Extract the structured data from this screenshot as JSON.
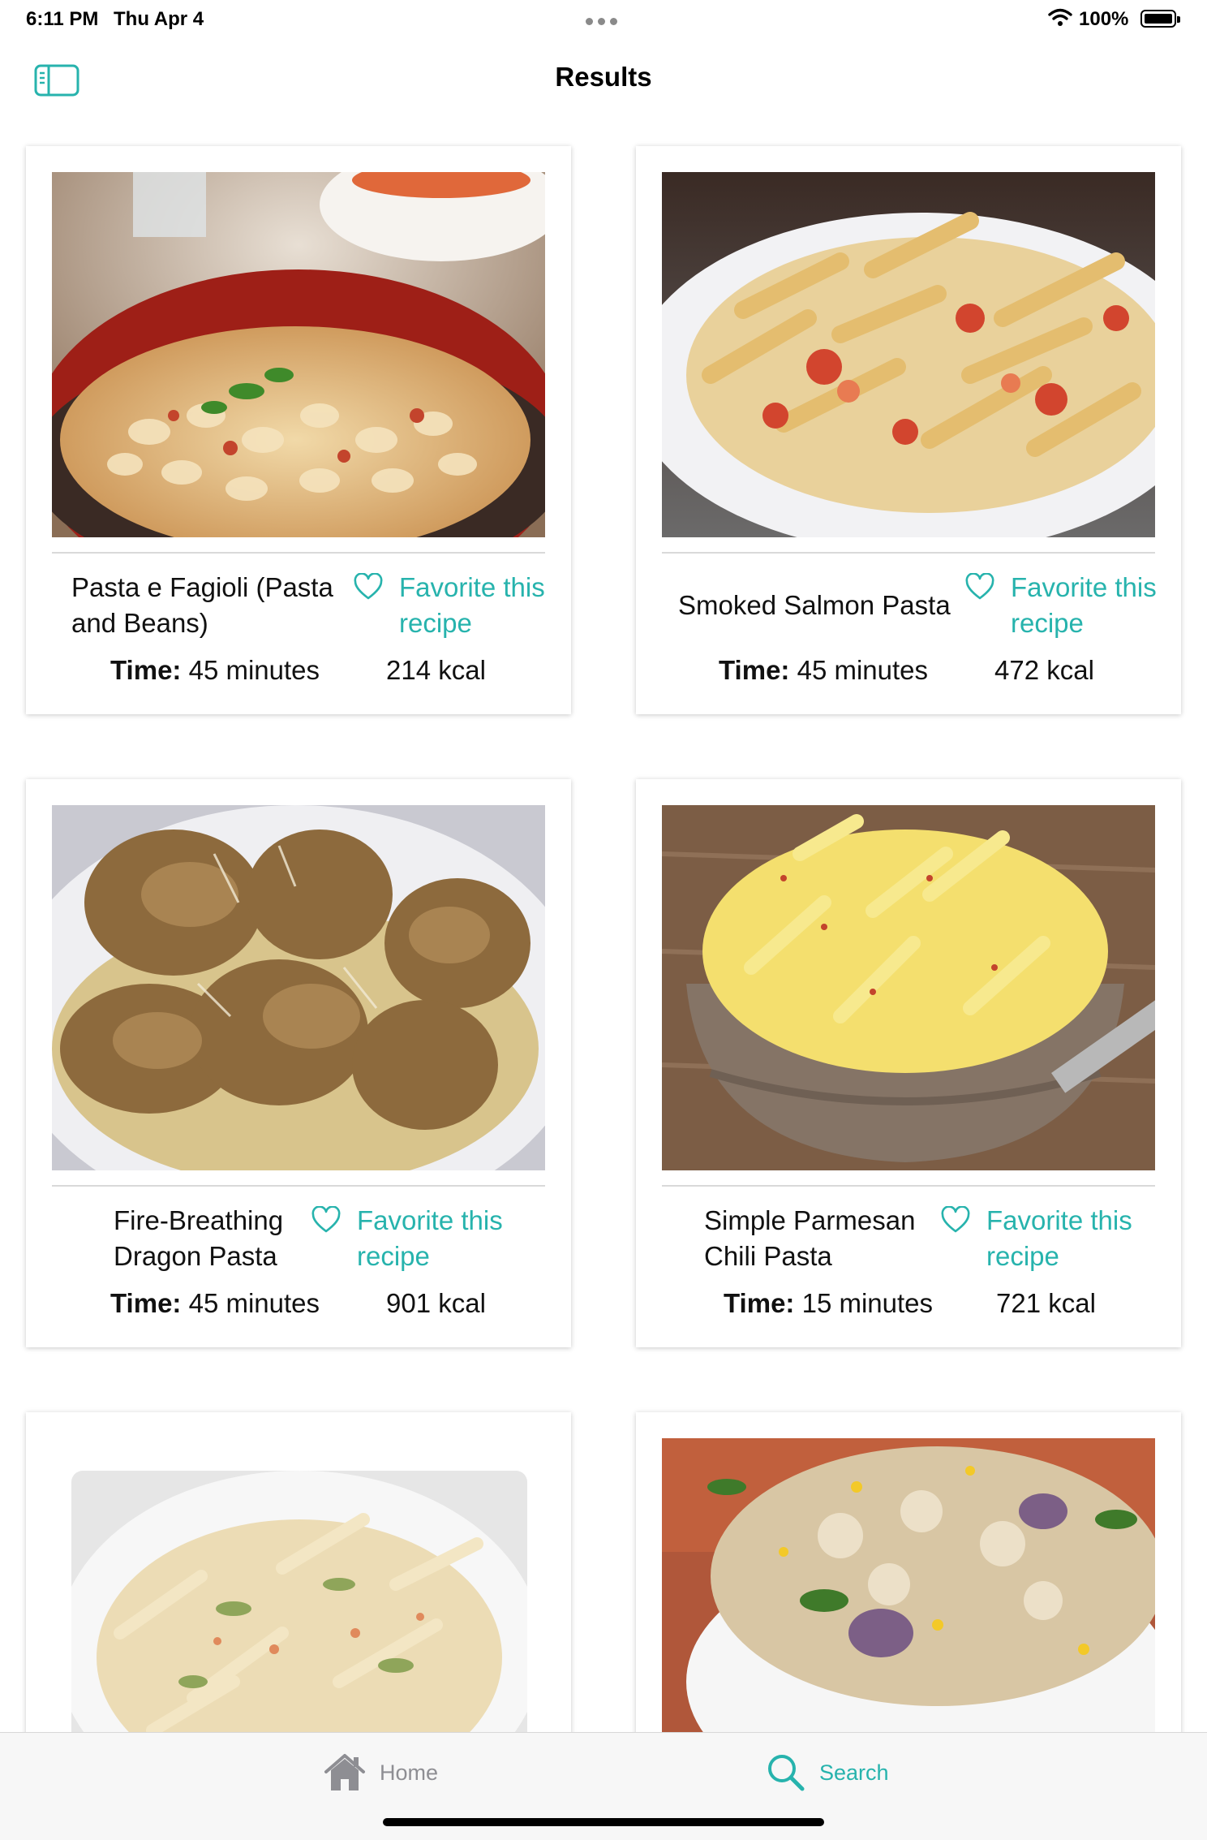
{
  "status_bar": {
    "time": "6:11 PM",
    "date": "Thu Apr 4",
    "battery_percent": "100%"
  },
  "nav": {
    "title": "Results",
    "sidebar_icon": "sidebar-toggle-icon"
  },
  "recipes": [
    {
      "title": "Pasta e Fagioli (Pasta and Beans)",
      "favorite_label": "Favorite this recipe",
      "time_label": "Time:",
      "time_value": " 45 minutes",
      "calories": "214 kcal"
    },
    {
      "title": "Smoked Salmon Pasta",
      "favorite_label": "Favorite this recipe",
      "time_label": "Time:",
      "time_value": " 45 minutes",
      "calories": "472 kcal"
    },
    {
      "title": "Fire-Breathing Dragon Pasta",
      "favorite_label": "Favorite this recipe",
      "time_label": "Time:",
      "time_value": " 45 minutes",
      "calories": "901 kcal"
    },
    {
      "title": "Simple Parmesan Chili Pasta",
      "favorite_label": "Favorite this recipe",
      "time_label": "Time:",
      "time_value": " 15 minutes",
      "calories": "721 kcal"
    }
  ],
  "tab_bar": {
    "home_label": "Home",
    "search_label": "Search",
    "home_icon": "house-icon",
    "search_icon": "magnifier-icon"
  },
  "colors": {
    "accent": "#27b3ad",
    "inactive_tab": "#8e8e93"
  }
}
